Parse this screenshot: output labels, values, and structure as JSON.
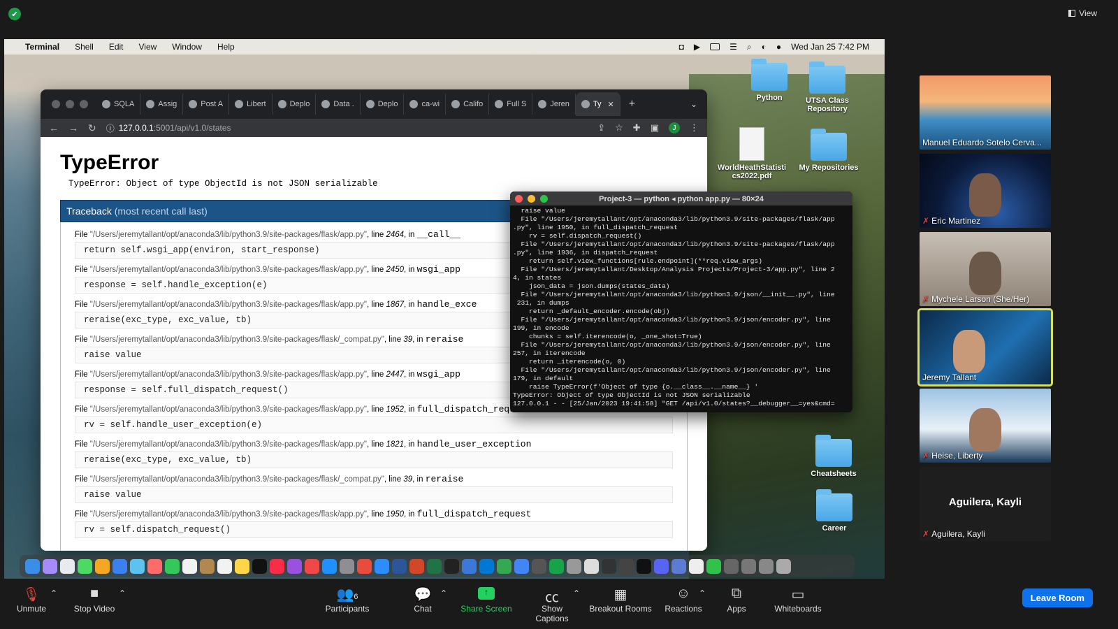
{
  "zoom": {
    "view_label": "View",
    "toolbar": {
      "unmute": "Unmute",
      "stop_video": "Stop Video",
      "participants": "Participants",
      "participants_count": "6",
      "chat": "Chat",
      "share_screen": "Share Screen",
      "show_captions": "Show Captions",
      "breakout_rooms": "Breakout Rooms",
      "reactions": "Reactions",
      "apps": "Apps",
      "whiteboards": "Whiteboards",
      "leave": "Leave Room"
    },
    "participants": [
      {
        "name": "Manuel Eduardo Sotelo Cerva...",
        "muted": false
      },
      {
        "name": "Eric Martinez",
        "muted": true
      },
      {
        "name": "Mychele Larson (She/Her)",
        "muted": true
      },
      {
        "name": "Jeremy Tallant",
        "muted": false,
        "active": true
      },
      {
        "name": "Heise, Liberty",
        "muted": true
      },
      {
        "name": "Aguilera, Kayli",
        "muted": true,
        "big_name": "Aguilera, Kayli"
      }
    ]
  },
  "mac": {
    "menu": {
      "app": "Terminal",
      "items": [
        "Shell",
        "Edit",
        "View",
        "Window",
        "Help"
      ],
      "datetime": "Wed Jan 25  7:42 PM"
    },
    "desktop_icons": [
      {
        "label": "Python"
      },
      {
        "label": "UTSA Class Repository"
      },
      {
        "label": "WorldHeathStatistics2022.pdf"
      },
      {
        "label": "My Repositories"
      },
      {
        "label": "Cheatsheets"
      },
      {
        "label": "Career"
      }
    ]
  },
  "browser": {
    "tabs": [
      "SQLA",
      "Assig",
      "Post A",
      "Libert",
      "Deplo",
      "Data .",
      "Deplo",
      "ca-wi",
      "Califo",
      "Full S",
      "Jeren",
      "Ty"
    ],
    "url_host": "127.0.0.1",
    "url_path": ":5001/api/v1.0/states",
    "profile": "J",
    "page": {
      "title": "TypeError",
      "message": "TypeError: Object of type ObjectId is not JSON serializable",
      "traceback_label": "Traceback",
      "traceback_sub": "(most recent call last)",
      "frames": [
        {
          "file": "\"/Users/jeremytallant/opt/anaconda3/lib/python3.9/site-packages/flask/app.py\"",
          "line": "2464",
          "func": "__call__",
          "code": "return self.wsgi_app(environ, start_response)"
        },
        {
          "file": "\"/Users/jeremytallant/opt/anaconda3/lib/python3.9/site-packages/flask/app.py\"",
          "line": "2450",
          "func": "wsgi_app",
          "code": "response = self.handle_exception(e)"
        },
        {
          "file": "\"/Users/jeremytallant/opt/anaconda3/lib/python3.9/site-packages/flask/app.py\"",
          "line": "1867",
          "func": "handle_exce",
          "code": "reraise(exc_type, exc_value, tb)"
        },
        {
          "file": "\"/Users/jeremytallant/opt/anaconda3/lib/python3.9/site-packages/flask/_compat.py\"",
          "line": "39",
          "func": "reraise",
          "code": "raise value"
        },
        {
          "file": "\"/Users/jeremytallant/opt/anaconda3/lib/python3.9/site-packages/flask/app.py\"",
          "line": "2447",
          "func": "wsgi_app",
          "code": "response = self.full_dispatch_request()"
        },
        {
          "file": "\"/Users/jeremytallant/opt/anaconda3/lib/python3.9/site-packages/flask/app.py\"",
          "line": "1952",
          "func": "full_dispatch_request",
          "code": "rv = self.handle_user_exception(e)"
        },
        {
          "file": "\"/Users/jeremytallant/opt/anaconda3/lib/python3.9/site-packages/flask/app.py\"",
          "line": "1821",
          "func": "handle_user_exception",
          "code": "reraise(exc_type, exc_value, tb)"
        },
        {
          "file": "\"/Users/jeremytallant/opt/anaconda3/lib/python3.9/site-packages/flask/_compat.py\"",
          "line": "39",
          "func": "reraise",
          "code": "raise value"
        },
        {
          "file": "\"/Users/jeremytallant/opt/anaconda3/lib/python3.9/site-packages/flask/app.py\"",
          "line": "1950",
          "func": "full_dispatch_request",
          "code": "rv = self.dispatch_request()"
        }
      ]
    }
  },
  "terminal": {
    "title": "Project-3 — python ◂ python app.py — 80×24",
    "lines": [
      "  raise value",
      "  File \"/Users/jeremytallant/opt/anaconda3/lib/python3.9/site-packages/flask/app",
      ".py\", line 1950, in full_dispatch_request",
      "    rv = self.dispatch_request()",
      "  File \"/Users/jeremytallant/opt/anaconda3/lib/python3.9/site-packages/flask/app",
      ".py\", line 1936, in dispatch_request",
      "    return self.view_functions[rule.endpoint](**req.view_args)",
      "  File \"/Users/jeremytallant/Desktop/Analysis Projects/Project-3/app.py\", line 2",
      "4, in states",
      "    json_data = json.dumps(states_data)",
      "  File \"/Users/jeremytallant/opt/anaconda3/lib/python3.9/json/__init__.py\", line",
      " 231, in dumps",
      "    return _default_encoder.encode(obj)",
      "  File \"/Users/jeremytallant/opt/anaconda3/lib/python3.9/json/encoder.py\", line",
      "199, in encode",
      "    chunks = self.iterencode(o, _one_shot=True)",
      "  File \"/Users/jeremytallant/opt/anaconda3/lib/python3.9/json/encoder.py\", line",
      "257, in iterencode",
      "    return _iterencode(o, 0)",
      "  File \"/Users/jeremytallant/opt/anaconda3/lib/python3.9/json/encoder.py\", line",
      "179, in default",
      "    raise TypeError(f'Object of type {o.__class__.__name__} '",
      "TypeError: Object of type ObjectId is not JSON serializable",
      "127.0.0.1 - - [25/Jan/2023 19:41:58] \"GET /api/v1.0/states?__debugger__=yes&cmd="
    ]
  },
  "colors": {
    "traceback_header": "#1d5487",
    "zoom_green": "#23d160",
    "leave_blue": "#0e72ed",
    "active_speaker": "#d8e05a",
    "muted_red": "#e0473a"
  }
}
